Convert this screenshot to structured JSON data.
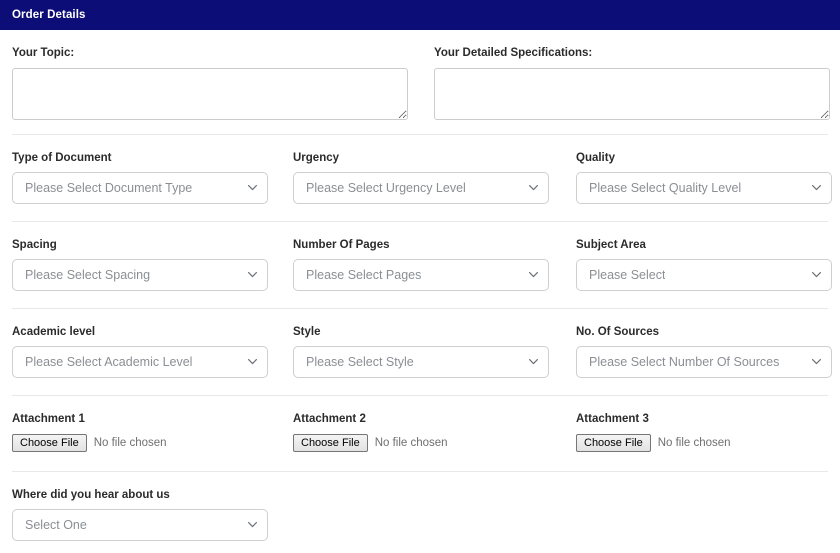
{
  "panel": {
    "title": "Order Details",
    "header_bg": "#0d0d78",
    "header_text_color": "#ffffff",
    "border_color": "#cfcfcf",
    "divider_color": "#e8e8e8",
    "placeholder_color": "#8b8f94"
  },
  "textareas": [
    {
      "label": "Your Topic:",
      "value": "",
      "placeholder": ""
    },
    {
      "label": "Your Detailed Specifications:",
      "value": "",
      "placeholder": ""
    }
  ],
  "fields": [
    {
      "label": "Type of Document",
      "selected": "Please Select Document Type",
      "icon": "chevron-down-icon"
    },
    {
      "label": "Urgency",
      "selected": "Please Select Urgency Level",
      "icon": "chevron-down-icon"
    },
    {
      "label": "Quality",
      "selected": "Please Select Quality Level",
      "icon": "chevron-down-icon"
    },
    {
      "label": "Spacing",
      "selected": "Please Select Spacing",
      "icon": "chevron-down-icon"
    },
    {
      "label": "Number Of Pages",
      "selected": "Please Select Pages",
      "icon": "chevron-down-icon"
    },
    {
      "label": "Subject Area",
      "selected": "Please Select",
      "icon": "chevron-down-icon"
    },
    {
      "label": "Academic level",
      "selected": "Please Select Academic Level",
      "icon": "chevron-down-icon"
    },
    {
      "label": "Style",
      "selected": "Please Select Style",
      "icon": "chevron-down-icon"
    },
    {
      "label": "No. Of Sources",
      "selected": "Please Select Number Of Sources",
      "icon": "chevron-down-icon"
    }
  ],
  "attachments": [
    {
      "label": "Attachment 1",
      "button": "Choose File",
      "status": "No file chosen"
    },
    {
      "label": "Attachment 2",
      "button": "Choose File",
      "status": "No file chosen"
    },
    {
      "label": "Attachment 3",
      "button": "Choose File",
      "status": "No file chosen"
    }
  ],
  "referral": {
    "label": "Where did you hear about us",
    "selected": "Select One",
    "icon": "chevron-down-icon"
  }
}
